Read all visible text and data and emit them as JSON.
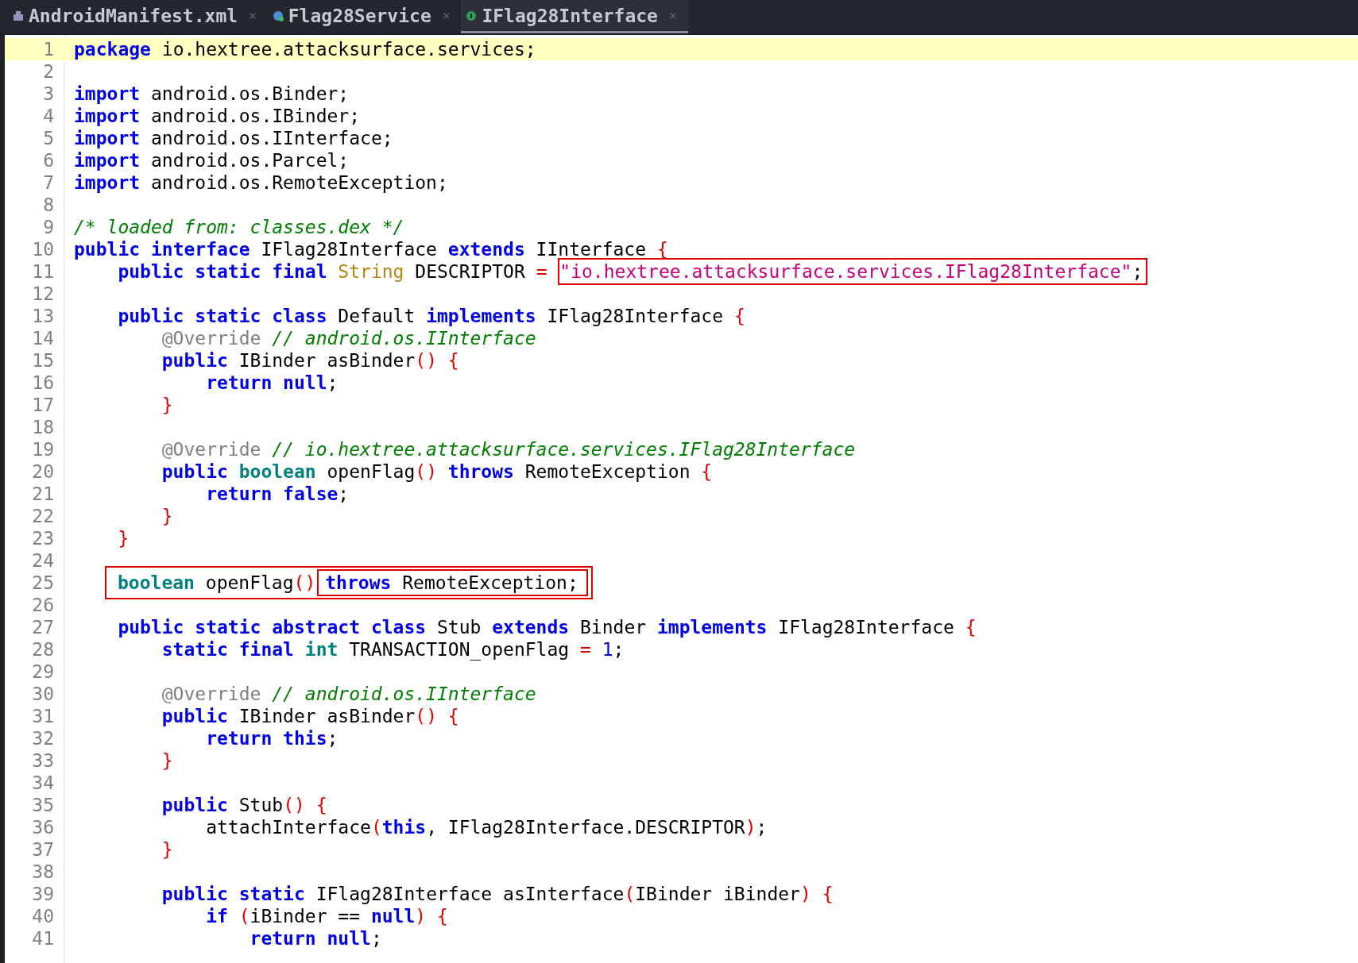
{
  "tabs": [
    {
      "label": "AndroidManifest.xml",
      "kind": "manifest",
      "close": "×",
      "selected": false
    },
    {
      "label": "Flag28Service",
      "kind": "class",
      "close": "×",
      "selected": false
    },
    {
      "label": "IFlag28Interface",
      "kind": "interface",
      "close": "×",
      "selected": true
    }
  ],
  "lines": [
    {
      "n": "1",
      "current": true,
      "code": [
        {
          "kind": "kw",
          "text": "package"
        },
        {
          "kind": "txt",
          "text": " io.hextree.attacksurface.services;"
        }
      ]
    },
    {
      "n": "2",
      "current": false
    },
    {
      "n": "3",
      "current": false,
      "code": [
        {
          "kind": "kw",
          "text": "import"
        },
        {
          "kind": "txt",
          "text": " android.os.Binder;"
        }
      ]
    },
    {
      "n": "4",
      "current": false,
      "code": [
        {
          "kind": "kw",
          "text": "import"
        },
        {
          "kind": "txt",
          "text": " android.os.IBinder;"
        }
      ]
    },
    {
      "n": "5",
      "current": false,
      "code": [
        {
          "kind": "kw",
          "text": "import"
        },
        {
          "kind": "txt",
          "text": " android.os.IInterface;"
        }
      ]
    },
    {
      "n": "6",
      "current": false,
      "code": [
        {
          "kind": "kw",
          "text": "import"
        },
        {
          "kind": "txt",
          "text": " android.os.Parcel;"
        }
      ]
    },
    {
      "n": "7",
      "current": false,
      "code": [
        {
          "kind": "kw",
          "text": "import"
        },
        {
          "kind": "txt",
          "text": " android.os.RemoteException;"
        }
      ]
    },
    {
      "n": "8",
      "current": false
    },
    {
      "n": "9",
      "current": false,
      "code": [
        {
          "kind": "cmt",
          "text": "/* loaded from: classes.dex */"
        }
      ]
    },
    {
      "n": "10",
      "current": false,
      "code": [
        {
          "kind": "kw",
          "text": "public "
        },
        {
          "kind": "kw",
          "text": "interface"
        },
        {
          "kind": "txt",
          "text": " IFlag28Interface "
        },
        {
          "kind": "kw",
          "text": "extends"
        },
        {
          "kind": "txt",
          "text": " IInterface "
        },
        {
          "kind": "pun",
          "text": "{"
        }
      ]
    },
    {
      "n": "11",
      "current": false,
      "code": [
        {
          "kind": "kw",
          "text": "    public "
        },
        {
          "kind": "kw",
          "text": "static "
        },
        {
          "kind": "kw",
          "text": "final "
        },
        {
          "kind": "cls",
          "text": "String"
        },
        {
          "kind": "txt",
          "text": " DESCRIPTOR "
        },
        {
          "kind": "pun",
          "text": "= "
        },
        {
          "kind": "box",
          "items": [
            {
              "kind": "str",
              "text": "\"io.hextree.attacksurface.services.IFlag28Interface\""
            },
            {
              "kind": "txt",
              "text": ";"
            }
          ]
        }
      ]
    },
    {
      "n": "12",
      "current": false
    },
    {
      "n": "13",
      "current": false,
      "code": [
        {
          "kind": "kw",
          "text": "    public "
        },
        {
          "kind": "kw",
          "text": "static "
        },
        {
          "kind": "kw",
          "text": "class"
        },
        {
          "kind": "txt",
          "text": " Default "
        },
        {
          "kind": "kw",
          "text": "implements"
        },
        {
          "kind": "txt",
          "text": " IFlag28Interface "
        },
        {
          "kind": "pun",
          "text": "{"
        }
      ]
    },
    {
      "n": "14",
      "current": false,
      "code": [
        {
          "kind": "ann",
          "text": "        @Override "
        },
        {
          "kind": "cmt",
          "text": "// android.os.IInterface"
        }
      ]
    },
    {
      "n": "15",
      "current": false,
      "code": [
        {
          "kind": "kw",
          "text": "        public"
        },
        {
          "kind": "txt",
          "text": " IBinder asBinder"
        },
        {
          "kind": "pun",
          "text": "() {"
        }
      ]
    },
    {
      "n": "16",
      "current": false,
      "code": [
        {
          "kind": "kw",
          "text": "            return "
        },
        {
          "kind": "kw",
          "text": "null"
        },
        {
          "kind": "txt",
          "text": ";"
        }
      ]
    },
    {
      "n": "17",
      "current": false,
      "code": [
        {
          "kind": "pun",
          "text": "        }"
        }
      ]
    },
    {
      "n": "18",
      "current": false
    },
    {
      "n": "19",
      "current": false,
      "code": [
        {
          "kind": "ann",
          "text": "        @Override "
        },
        {
          "kind": "cmt",
          "text": "// io.hextree.attacksurface.services.IFlag28Interface"
        }
      ]
    },
    {
      "n": "20",
      "current": false,
      "code": [
        {
          "kind": "kw",
          "text": "        public "
        },
        {
          "kind": "type",
          "text": "boolean"
        },
        {
          "kind": "txt",
          "text": " openFlag"
        },
        {
          "kind": "pun",
          "text": "() "
        },
        {
          "kind": "kw",
          "text": "throws"
        },
        {
          "kind": "txt",
          "text": " RemoteException "
        },
        {
          "kind": "pun",
          "text": "{"
        }
      ]
    },
    {
      "n": "21",
      "current": false,
      "code": [
        {
          "kind": "kw",
          "text": "            return "
        },
        {
          "kind": "kw",
          "text": "false"
        },
        {
          "kind": "txt",
          "text": ";"
        }
      ]
    },
    {
      "n": "22",
      "current": false,
      "code": [
        {
          "kind": "pun",
          "text": "        }"
        }
      ]
    },
    {
      "n": "23",
      "current": false,
      "code": [
        {
          "kind": "pun",
          "text": "    }"
        }
      ]
    },
    {
      "n": "24",
      "current": false
    },
    {
      "n": "25",
      "current": false,
      "code": [
        {
          "kind": "box",
          "items": [
            {
              "kind": "type",
              "text": "boolean"
            },
            {
              "kind": "txt",
              "text": " openFlag"
            },
            {
              "kind": "pun",
              "text": "()"
            },
            {
              "kind": "box",
              "items": [
                {
                  "kind": "kw",
                  "text": "throws"
                },
                {
                  "kind": "txt",
                  "text": " RemoteException;"
                }
              ]
            }
          ]
        }
      ]
    },
    {
      "n": "26",
      "current": false
    },
    {
      "n": "27",
      "current": false,
      "code": [
        {
          "kind": "kw",
          "text": "    public "
        },
        {
          "kind": "kw",
          "text": "static "
        },
        {
          "kind": "kw",
          "text": "abstract "
        },
        {
          "kind": "kw",
          "text": "class"
        },
        {
          "kind": "txt",
          "text": " Stub "
        },
        {
          "kind": "kw",
          "text": "extends"
        },
        {
          "kind": "txt",
          "text": " Binder "
        },
        {
          "kind": "kw",
          "text": "implements"
        },
        {
          "kind": "txt",
          "text": " IFlag28Interface "
        },
        {
          "kind": "pun",
          "text": "{"
        }
      ]
    },
    {
      "n": "28",
      "current": false,
      "code": [
        {
          "kind": "kw",
          "text": "        static "
        },
        {
          "kind": "kw",
          "text": "final "
        },
        {
          "kind": "type",
          "text": "int"
        },
        {
          "kind": "txt",
          "text": " TRANSACTION_openFlag "
        },
        {
          "kind": "pun",
          "text": "= "
        },
        {
          "kind": "num",
          "text": "1"
        },
        {
          "kind": "txt",
          "text": ";"
        }
      ]
    },
    {
      "n": "29",
      "current": false
    },
    {
      "n": "30",
      "current": false,
      "code": [
        {
          "kind": "ann",
          "text": "        @Override "
        },
        {
          "kind": "cmt",
          "text": "// android.os.IInterface"
        }
      ]
    },
    {
      "n": "31",
      "current": false,
      "code": [
        {
          "kind": "kw",
          "text": "        public"
        },
        {
          "kind": "txt",
          "text": " IBinder asBinder"
        },
        {
          "kind": "pun",
          "text": "() {"
        }
      ]
    },
    {
      "n": "32",
      "current": false,
      "code": [
        {
          "kind": "kw",
          "text": "            return "
        },
        {
          "kind": "kw",
          "text": "this"
        },
        {
          "kind": "txt",
          "text": ";"
        }
      ]
    },
    {
      "n": "33",
      "current": false,
      "code": [
        {
          "kind": "pun",
          "text": "        }"
        }
      ]
    },
    {
      "n": "34",
      "current": false
    },
    {
      "n": "35",
      "current": false,
      "code": [
        {
          "kind": "kw",
          "text": "        public"
        },
        {
          "kind": "txt",
          "text": " Stub"
        },
        {
          "kind": "pun",
          "text": "() {"
        }
      ]
    },
    {
      "n": "36",
      "current": false,
      "code": [
        {
          "kind": "txt",
          "text": "            attachInterface"
        },
        {
          "kind": "pun",
          "text": "("
        },
        {
          "kind": "kw",
          "text": "this"
        },
        {
          "kind": "txt",
          "text": ", IFlag28Interface.DESCRIPTOR"
        },
        {
          "kind": "pun",
          "text": ")"
        },
        {
          "kind": "txt",
          "text": ";"
        }
      ]
    },
    {
      "n": "37",
      "current": false,
      "code": [
        {
          "kind": "pun",
          "text": "        }"
        }
      ]
    },
    {
      "n": "38",
      "current": false
    },
    {
      "n": "39",
      "current": false,
      "code": [
        {
          "kind": "kw",
          "text": "        public "
        },
        {
          "kind": "kw",
          "text": "static"
        },
        {
          "kind": "txt",
          "text": " IFlag28Interface asInterface"
        },
        {
          "kind": "pun",
          "text": "("
        },
        {
          "kind": "txt",
          "text": "IBinder iBinder"
        },
        {
          "kind": "pun",
          "text": ") {"
        }
      ]
    },
    {
      "n": "40",
      "current": false,
      "code": [
        {
          "kind": "kw",
          "text": "            if "
        },
        {
          "kind": "pun",
          "text": "("
        },
        {
          "kind": "txt",
          "text": "iBinder == "
        },
        {
          "kind": "kw",
          "text": "null"
        },
        {
          "kind": "pun",
          "text": ") {"
        }
      ]
    },
    {
      "n": "41",
      "current": false,
      "code": [
        {
          "kind": "kw",
          "text": "                return "
        },
        {
          "kind": "kw",
          "text": "null"
        },
        {
          "kind": "txt",
          "text": ";"
        }
      ]
    }
  ]
}
